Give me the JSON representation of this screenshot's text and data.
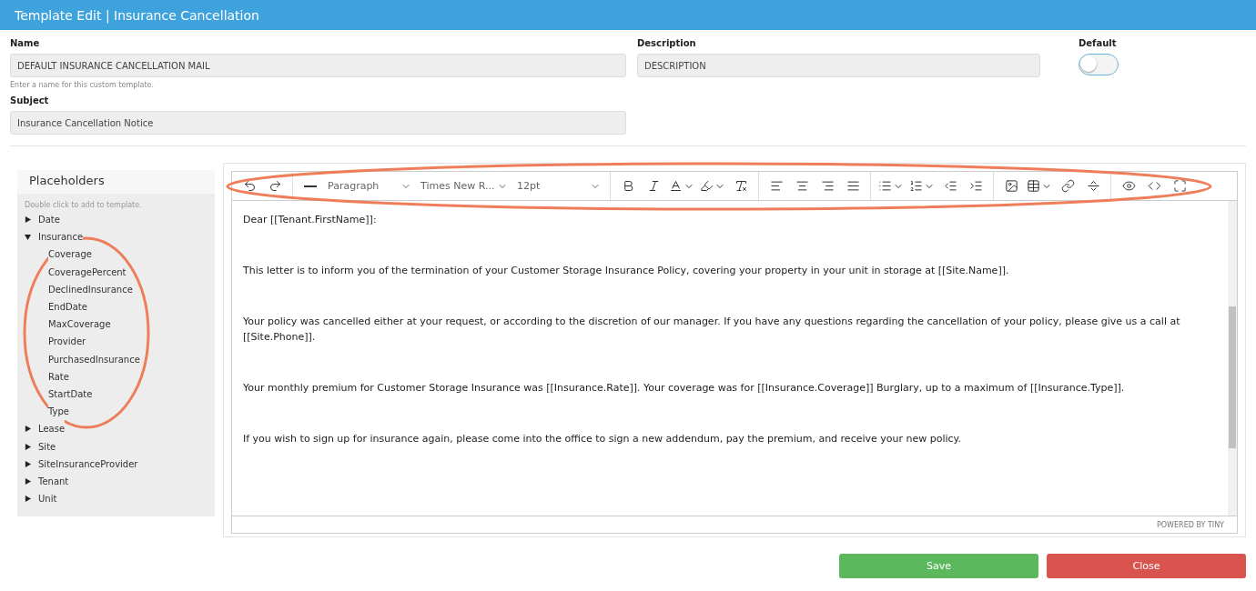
{
  "window": {
    "title": "Template Edit | Insurance Cancellation"
  },
  "fields": {
    "name": {
      "label": "Name",
      "value": "DEFAULT INSURANCE CANCELLATION MAIL",
      "hint": "Enter a name for this custom template."
    },
    "description": {
      "label": "Description",
      "value": "DESCRIPTION"
    },
    "default": {
      "label": "Default",
      "on": false
    },
    "subject": {
      "label": "Subject",
      "value": "Insurance Cancellation Notice"
    }
  },
  "placeholders": {
    "title": "Placeholders",
    "hint": "Double click to add to template.",
    "items": [
      {
        "label": "Date",
        "expanded": false
      },
      {
        "label": "Insurance",
        "expanded": true,
        "children": [
          {
            "label": "Coverage"
          },
          {
            "label": "CoveragePercent"
          },
          {
            "label": "DeclinedInsurance"
          },
          {
            "label": "EndDate"
          },
          {
            "label": "MaxCoverage"
          },
          {
            "label": "Provider"
          },
          {
            "label": "PurchasedInsurance"
          },
          {
            "label": "Rate"
          },
          {
            "label": "StartDate"
          },
          {
            "label": "Type"
          }
        ]
      },
      {
        "label": "Lease",
        "expanded": false
      },
      {
        "label": "Site",
        "expanded": false
      },
      {
        "label": "SiteInsuranceProvider",
        "expanded": false
      },
      {
        "label": "Tenant",
        "expanded": false
      },
      {
        "label": "Unit",
        "expanded": false
      }
    ]
  },
  "editor": {
    "block_format": "Paragraph",
    "font_family": "Times New R...",
    "font_size": "12pt",
    "paragraphs": [
      "Dear [[Tenant.FirstName]]:",
      "This letter is to inform you of the termination of your Customer Storage Insurance Policy, covering your property in your unit in storage at [[Site.Name]].",
      "Your policy was cancelled either at your request, or according to the discretion of our manager. If you have any questions regarding the cancellation of your policy, please give us a call at [[Site.Phone]].",
      "Your monthly premium for Customer Storage Insurance was [[Insurance.Rate]]. Your coverage was for [[Insurance.Coverage]] Burglary, up to a maximum of [[Insurance.Type]].",
      "If you wish to sign up for insurance again, please come into the office to sign a new addendum, pay the premium, and receive your new policy."
    ],
    "branding": "POWERED BY TINY"
  },
  "buttons": [
    {
      "label": "Save",
      "kind": "save"
    },
    {
      "label": "Close",
      "kind": "close"
    }
  ]
}
